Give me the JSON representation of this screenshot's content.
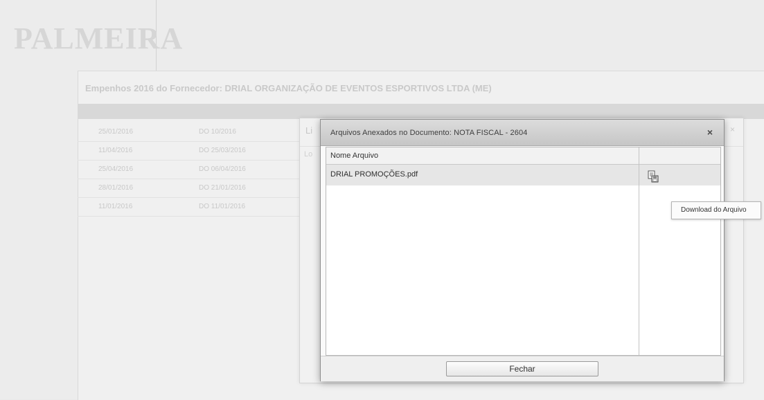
{
  "background": {
    "logo_text": "PALMEIRA",
    "panel_title": "Empenhos 2016 do Fornecedor: DRIAL ORGANIZAÇÃO DE EVENTOS ESPORTIVOS LTDA (ME)",
    "rows": [
      {
        "date": "25/01/2016",
        "doc": "DO 10/2016"
      },
      {
        "date": "11/04/2016",
        "doc": "DO 25/03/2016"
      },
      {
        "date": "25/04/2016",
        "doc": "DO 06/04/2016"
      },
      {
        "date": "28/01/2016",
        "doc": "DO 21/01/2016"
      },
      {
        "date": "11/01/2016",
        "doc": "DO 11/01/2016"
      }
    ],
    "dialog_title": "Li",
    "dialog_col": "Lo"
  },
  "modal": {
    "title": "Arquivos Anexados no Documento: NOTA FISCAL - 2604",
    "close_label": "×",
    "column_header": "Nome Arquivo",
    "files": [
      {
        "name": "DRIAL PROMOÇÕES.pdf",
        "action_icon": "download-icon"
      }
    ],
    "close_button_label": "Fechar"
  },
  "tooltip": {
    "text": "Download do Arquivo"
  }
}
